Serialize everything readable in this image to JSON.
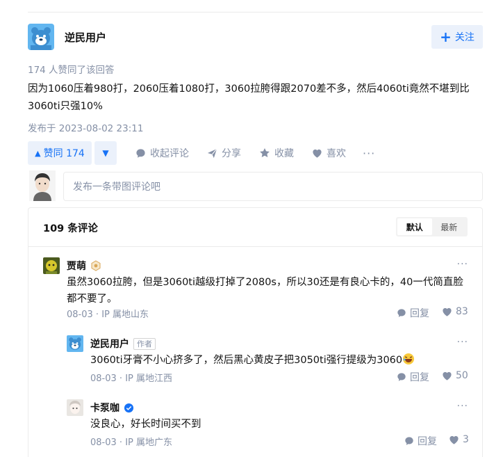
{
  "answer": {
    "author_name": "逆民用户",
    "follow_label": "关注",
    "agree_text": "174 人赞同了该回答",
    "content_line1": "因为1060压着980打，2060压着1080打，3060拉胯得跟2070差不多，然后4060ti竟然不堪到比",
    "content_line2": "3060ti只强10%",
    "publish_time": "发布于 2023-08-02 23:11",
    "actions": {
      "upvote_label": "赞同 174",
      "collapse_comments": "收起评论",
      "share": "分享",
      "collect": "收藏",
      "like": "喜欢",
      "more": "···"
    }
  },
  "comment_input": {
    "placeholder": "发布一条带图评论吧"
  },
  "comments": {
    "count_label": "109 条评论",
    "sort": {
      "default": "默认",
      "latest": "最新"
    },
    "items": [
      {
        "name": "贾萌",
        "text_line1": "虽然3060拉胯，但是3060ti越级打掉了2080s，所以30还是有良心卡的，40一代简直脸",
        "text_line2": "都不要了。",
        "date": "08-03",
        "ip": "IP 属地山东",
        "reply": "回复",
        "likes": "83"
      },
      {
        "name": "逆民用户",
        "tag": "作者",
        "text": "3060ti牙膏不小心挤多了，然后黑心黄皮子把3050ti强行提级为3060",
        "date": "08-03",
        "ip": "IP 属地江西",
        "reply": "回复",
        "likes": "50"
      },
      {
        "name": "卡泵咖",
        "text": "没良心，好长时间买不到",
        "date": "08-03",
        "ip": "IP 属地广东",
        "reply": "回复",
        "likes": "3"
      }
    ]
  },
  "colors": {
    "accent": "#1772f6",
    "accent_bg": "#ebf1fb",
    "meta": "#8590a6"
  }
}
